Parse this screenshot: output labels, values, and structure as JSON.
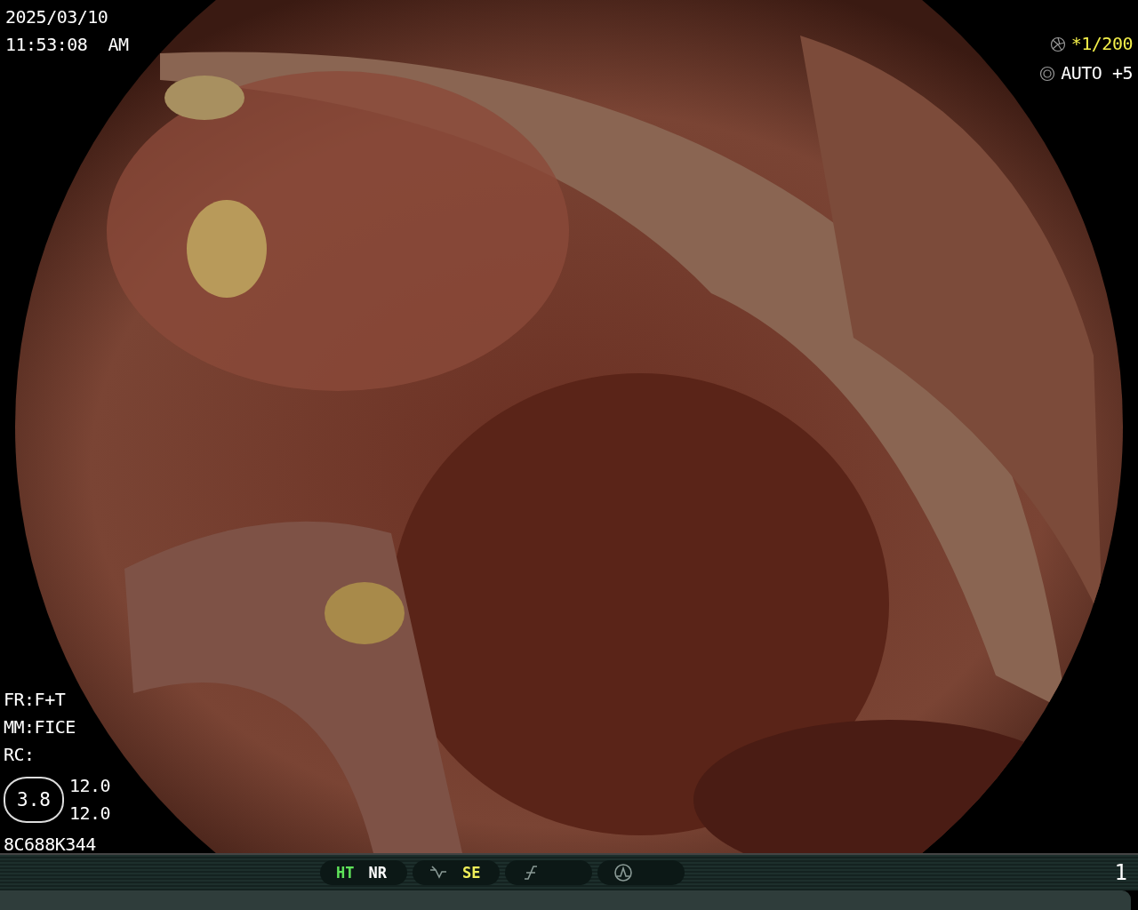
{
  "timestamp": {
    "date": "2025/03/10",
    "time": "11:53:08  AM"
  },
  "exposure": [
    {
      "kind": "shutter",
      "value": "*1/200",
      "color": "#f4f04a"
    },
    {
      "kind": "iris",
      "value": "AUTO +5",
      "color": "#ffffff"
    }
  ],
  "settings": [
    "FR:F+T",
    "MM:FICE",
    "RC:"
  ],
  "gauge": {
    "value": "3.8",
    "readings": [
      "12.0",
      "12.0"
    ]
  },
  "serial": "8C688K344",
  "status_bar": {
    "groups": [
      {
        "items": [
          {
            "kind": "text",
            "label": "HT",
            "color": "#5fe35a"
          },
          {
            "kind": "text",
            "label": "NR",
            "color": "#ffffff"
          }
        ]
      },
      {
        "items": [
          {
            "kind": "curve-icon"
          },
          {
            "kind": "text",
            "label": "SE",
            "color": "#f0ef5a"
          }
        ]
      },
      {
        "items": [
          {
            "kind": "slash-icon"
          }
        ]
      },
      {
        "items": [
          {
            "kind": "peak-icon"
          }
        ]
      }
    ],
    "page": "1"
  }
}
